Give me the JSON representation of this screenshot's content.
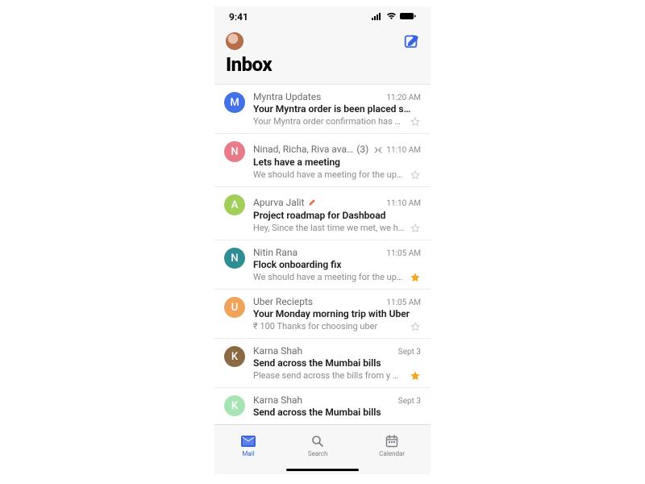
{
  "status": {
    "time": "9:41"
  },
  "header": {
    "title": "Inbox"
  },
  "rows": [
    {
      "initial": "M",
      "color": "#4472e6",
      "sender": "Myntra Updates",
      "thread": "",
      "draft": false,
      "time": "11:20 AM",
      "subject": "Your Myntra order is been placed suc…",
      "preview": "Your Myntra order confirmation has b…",
      "starred": false,
      "hidePreview": false
    },
    {
      "initial": "N",
      "color": "#e97a8a",
      "sender": "Ninad, Richa, Riva availa…",
      "thread": "(3)",
      "threadIcon": true,
      "draft": false,
      "time": "11:10 AM",
      "subject": "Lets have a meeting",
      "preview": "We should have a meeting for the up…",
      "starred": false,
      "hidePreview": false
    },
    {
      "initial": "A",
      "color": "#a1cf5a",
      "sender": "Apurva Jalit",
      "thread": "",
      "draft": true,
      "time": "11:10 AM",
      "subject": "Project roadmap for Dashboad",
      "preview": "Hey, Since the last time we met, we h…",
      "starred": false,
      "hidePreview": false
    },
    {
      "initial": "N",
      "color": "#2f8e93",
      "sender": "Nitin Rana",
      "thread": "",
      "draft": false,
      "time": "11:05 AM",
      "subject": "Flock onboarding fix",
      "preview": "We should have a meeting for the up…",
      "starred": true,
      "hidePreview": false
    },
    {
      "initial": "U",
      "color": "#f0a35b",
      "sender": "Uber Reciepts",
      "thread": "",
      "draft": false,
      "time": "11:05 AM",
      "subject": "Your Monday morning trip with Uber",
      "preview": "₹ 100 Thanks for choosing uber",
      "starred": false,
      "hidePreview": false
    },
    {
      "initial": "K",
      "color": "#8a6a42",
      "sender": "Karna Shah",
      "thread": "",
      "draft": false,
      "time": "Sept 3",
      "subject": "Send across the Mumbai bills",
      "preview": "Please send across the bills from y …",
      "starred": true,
      "hidePreview": false
    },
    {
      "initial": "K",
      "color": "#a8e3b4",
      "sender": "Karna Shah",
      "thread": "",
      "draft": false,
      "time": "Sept 3",
      "subject": "Send across the Mumbai bills",
      "preview": "",
      "starred": false,
      "hidePreview": true
    }
  ],
  "tabs": {
    "mail": "Mail",
    "search": "Search",
    "calendar": "Calendar"
  }
}
